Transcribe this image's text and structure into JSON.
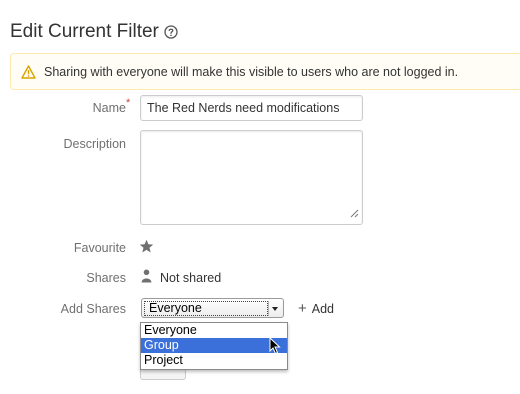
{
  "header": {
    "title": "Edit Current Filter",
    "help_icon": "help-icon"
  },
  "warning": {
    "icon": "warning-icon",
    "message": "Sharing with everyone will make this visible to users who are not logged in."
  },
  "form": {
    "name_label": "Name",
    "required_marker": "*",
    "name_value": "The Red Nerds need modifications",
    "description_label": "Description",
    "description_value": "",
    "favourite_label": "Favourite",
    "favourite_icon": "star-icon",
    "shares_label": "Shares",
    "shares_icon": "person-icon",
    "shares_value": "Not shared",
    "add_shares_label": "Add Shares",
    "share_type_selected": "Everyone",
    "share_type_options": [
      "Everyone",
      "Group",
      "Project"
    ],
    "share_type_highlighted": "Group",
    "add_label": "Add"
  },
  "colors": {
    "highlight": "#3b6fd9",
    "warning_bg": "#fffdf6",
    "warning_border": "#ffeaae",
    "required": "#d04437"
  }
}
